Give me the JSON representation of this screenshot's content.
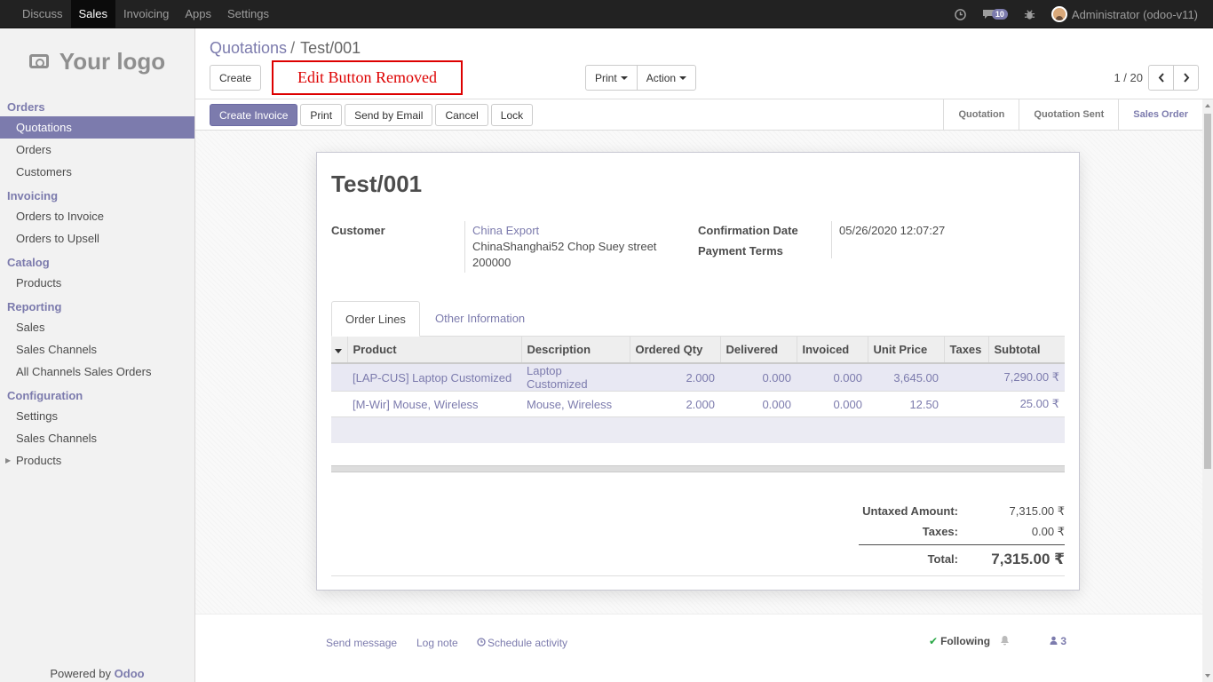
{
  "topbar": {
    "menu": [
      "Discuss",
      "Sales",
      "Invoicing",
      "Apps",
      "Settings"
    ],
    "active": "Sales",
    "messages_count": "10",
    "user": "Administrator (odoo-v11)"
  },
  "sidebar": {
    "logo_text": "Your logo",
    "sections": [
      {
        "title": "Orders",
        "items": [
          "Quotations",
          "Orders",
          "Customers"
        ]
      },
      {
        "title": "Invoicing",
        "items": [
          "Orders to Invoice",
          "Orders to Upsell"
        ]
      },
      {
        "title": "Catalog",
        "items": [
          "Products"
        ]
      },
      {
        "title": "Reporting",
        "items": [
          "Sales",
          "Sales Channels",
          "All Channels Sales Orders"
        ]
      },
      {
        "title": "Configuration",
        "items": [
          "Settings",
          "Sales Channels",
          "Products"
        ]
      }
    ],
    "powered_prefix": "Powered by",
    "powered_brand": "Odoo"
  },
  "control_panel": {
    "breadcrumb_parent": "Quotations",
    "breadcrumb_sep": "/",
    "breadcrumb_current": "Test/001",
    "create_label": "Create",
    "edit_removed_note": "Edit Button Removed",
    "print_label": "Print",
    "action_label": "Action",
    "pager_value": "1 / 20"
  },
  "statusbar": {
    "buttons": [
      "Create Invoice",
      "Print",
      "Send by Email",
      "Cancel",
      "Lock"
    ],
    "steps": [
      "Quotation",
      "Quotation Sent",
      "Sales Order"
    ],
    "active_step": "Sales Order"
  },
  "form": {
    "title": "Test/001",
    "customer_label": "Customer",
    "customer_name": "China Export",
    "customer_address1": "ChinaShanghai52 Chop Suey street",
    "customer_address2": "200000",
    "confirmation_date_label": "Confirmation Date",
    "confirmation_date": "05/26/2020 12:07:27",
    "payment_terms_label": "Payment Terms",
    "tabs": [
      "Order Lines",
      "Other Information"
    ],
    "columns": [
      "Product",
      "Description",
      "Ordered Qty",
      "Delivered",
      "Invoiced",
      "Unit Price",
      "Taxes",
      "Subtotal"
    ],
    "lines": [
      {
        "product": "[LAP-CUS] Laptop Customized",
        "description": "Laptop Customized",
        "ordered": "2.000",
        "delivered": "0.000",
        "invoiced": "0.000",
        "unit_price": "3,645.00",
        "taxes": "",
        "subtotal": "7,290.00 ₹"
      },
      {
        "product": "[M-Wir] Mouse, Wireless",
        "description": "Mouse, Wireless",
        "ordered": "2.000",
        "delivered": "0.000",
        "invoiced": "0.000",
        "unit_price": "12.50",
        "taxes": "",
        "subtotal": "25.00 ₹"
      }
    ],
    "untaxed_label": "Untaxed Amount:",
    "untaxed_value": "7,315.00 ₹",
    "taxes_label": "Taxes:",
    "taxes_value": "0.00 ₹",
    "total_label": "Total:",
    "total_value": "7,315.00 ₹"
  },
  "chatter": {
    "send_message": "Send message",
    "log_note": "Log note",
    "schedule_activity": "Schedule activity",
    "following": "Following",
    "followers_count": "3"
  },
  "colors": {
    "brand": "#7c7bad",
    "topbar": "#222222",
    "edit_note": "#dd0000"
  }
}
